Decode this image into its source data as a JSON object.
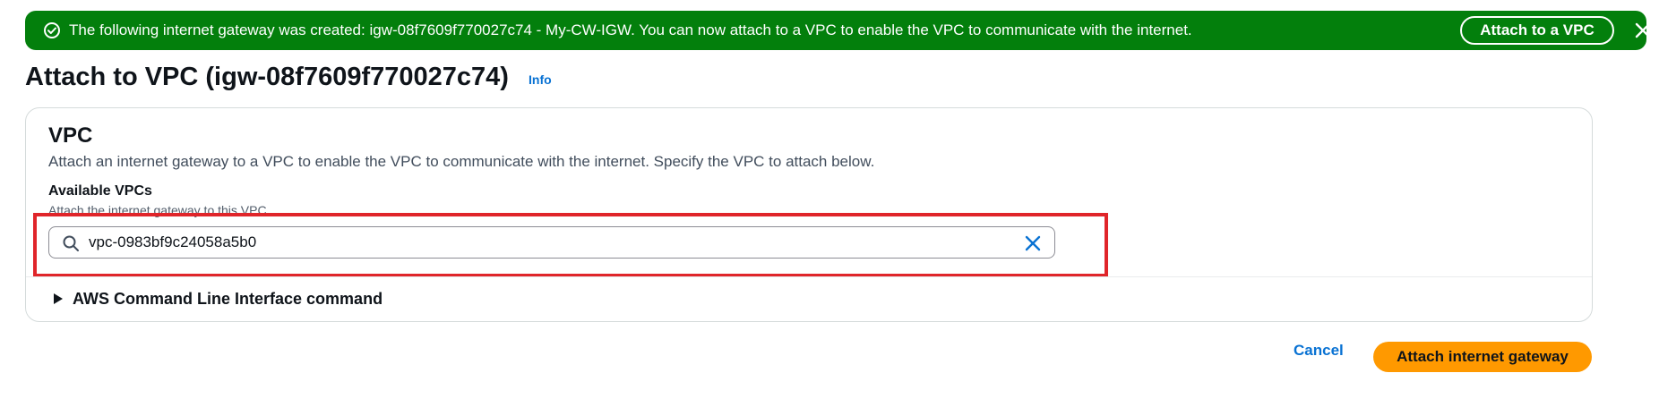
{
  "flash": {
    "message": "The following internet gateway was created: igw-08f7609f770027c74 - My-CW-IGW. You can now attach to a VPC to enable the VPC to communicate with the internet.",
    "action_label": "Attach to a VPC",
    "icons": {
      "status": "check-circle-icon",
      "dismiss": "close-icon"
    },
    "colors": {
      "background": "#037f0c",
      "text": "#ffffff"
    }
  },
  "header": {
    "title": "Attach to VPC (igw-08f7609f770027c74)",
    "info_link": "Info"
  },
  "vpc_panel": {
    "title": "VPC",
    "description": "Attach an internet gateway to a VPC to enable the VPC to communicate with the internet. Specify the VPC to attach below.",
    "field": {
      "label": "Available VPCs",
      "hint": "Attach the internet gateway to this VPC.",
      "value": "vpc-0983bf9c24058a5b0",
      "icons": {
        "search": "search-icon",
        "clear": "clear-icon"
      }
    },
    "expander": {
      "label": "AWS Command Line Interface command",
      "icon": "caret-right-icon",
      "expanded": false
    }
  },
  "actions": {
    "cancel_label": "Cancel",
    "submit_label": "Attach internet gateway",
    "colors": {
      "primary": "#ff9900",
      "link": "#0972d3"
    }
  },
  "annotation": {
    "highlight_color": "#e0252a"
  }
}
